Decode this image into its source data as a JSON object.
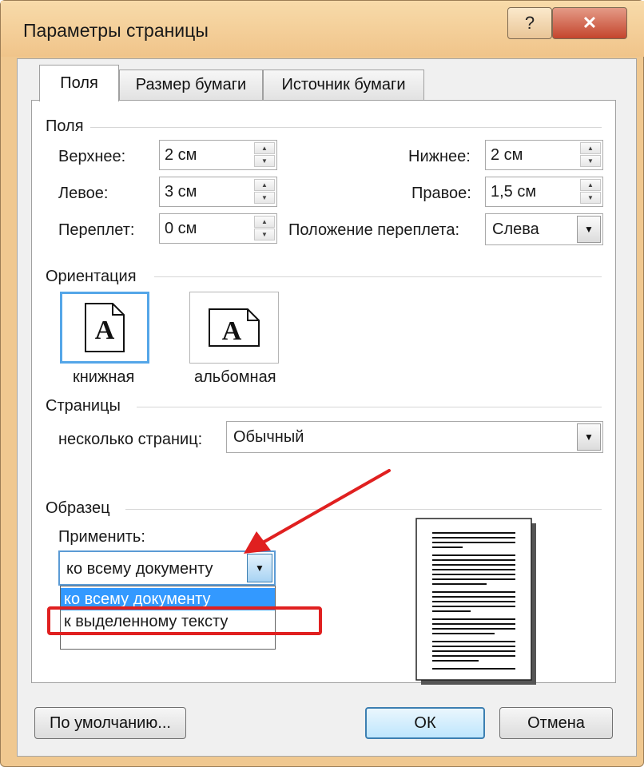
{
  "window": {
    "title": "Параметры страницы",
    "help_label": "?",
    "close_label": "✕"
  },
  "tabs": [
    {
      "label": "Поля"
    },
    {
      "label": "Размер бумаги"
    },
    {
      "label": "Источник бумаги"
    }
  ],
  "margins": {
    "group_title": "Поля",
    "top_label": "Верхнее:",
    "top_value": "2 см",
    "bottom_label": "Нижнее:",
    "bottom_value": "2 см",
    "left_label": "Левое:",
    "left_value": "3 см",
    "right_label": "Правое:",
    "right_value": "1,5 см",
    "gutter_label": "Переплет:",
    "gutter_value": "0 см",
    "gutter_pos_label": "Положение переплета:",
    "gutter_pos_value": "Слева"
  },
  "orientation": {
    "group_title": "Ориентация",
    "portrait_label": "книжная",
    "landscape_label": "альбомная",
    "icon_letter": "A"
  },
  "pages": {
    "group_title": "Страницы",
    "multiple_label": "несколько страниц:",
    "multiple_value": "Обычный"
  },
  "sample": {
    "group_title": "Образец",
    "apply_label": "Применить:",
    "apply_value": "ко всему документу",
    "options": [
      "ко всему документу",
      "к выделенному тексту"
    ]
  },
  "buttons": {
    "default_label": "По умолчанию...",
    "ok_label": "ОК",
    "cancel_label": "Отмена"
  },
  "colors": {
    "frame": "#f0c890",
    "close_button": "#c4452d",
    "selection_highlight": "#3399ff",
    "annotation_red": "#e02020",
    "focus_blue": "#5b9bd5"
  }
}
